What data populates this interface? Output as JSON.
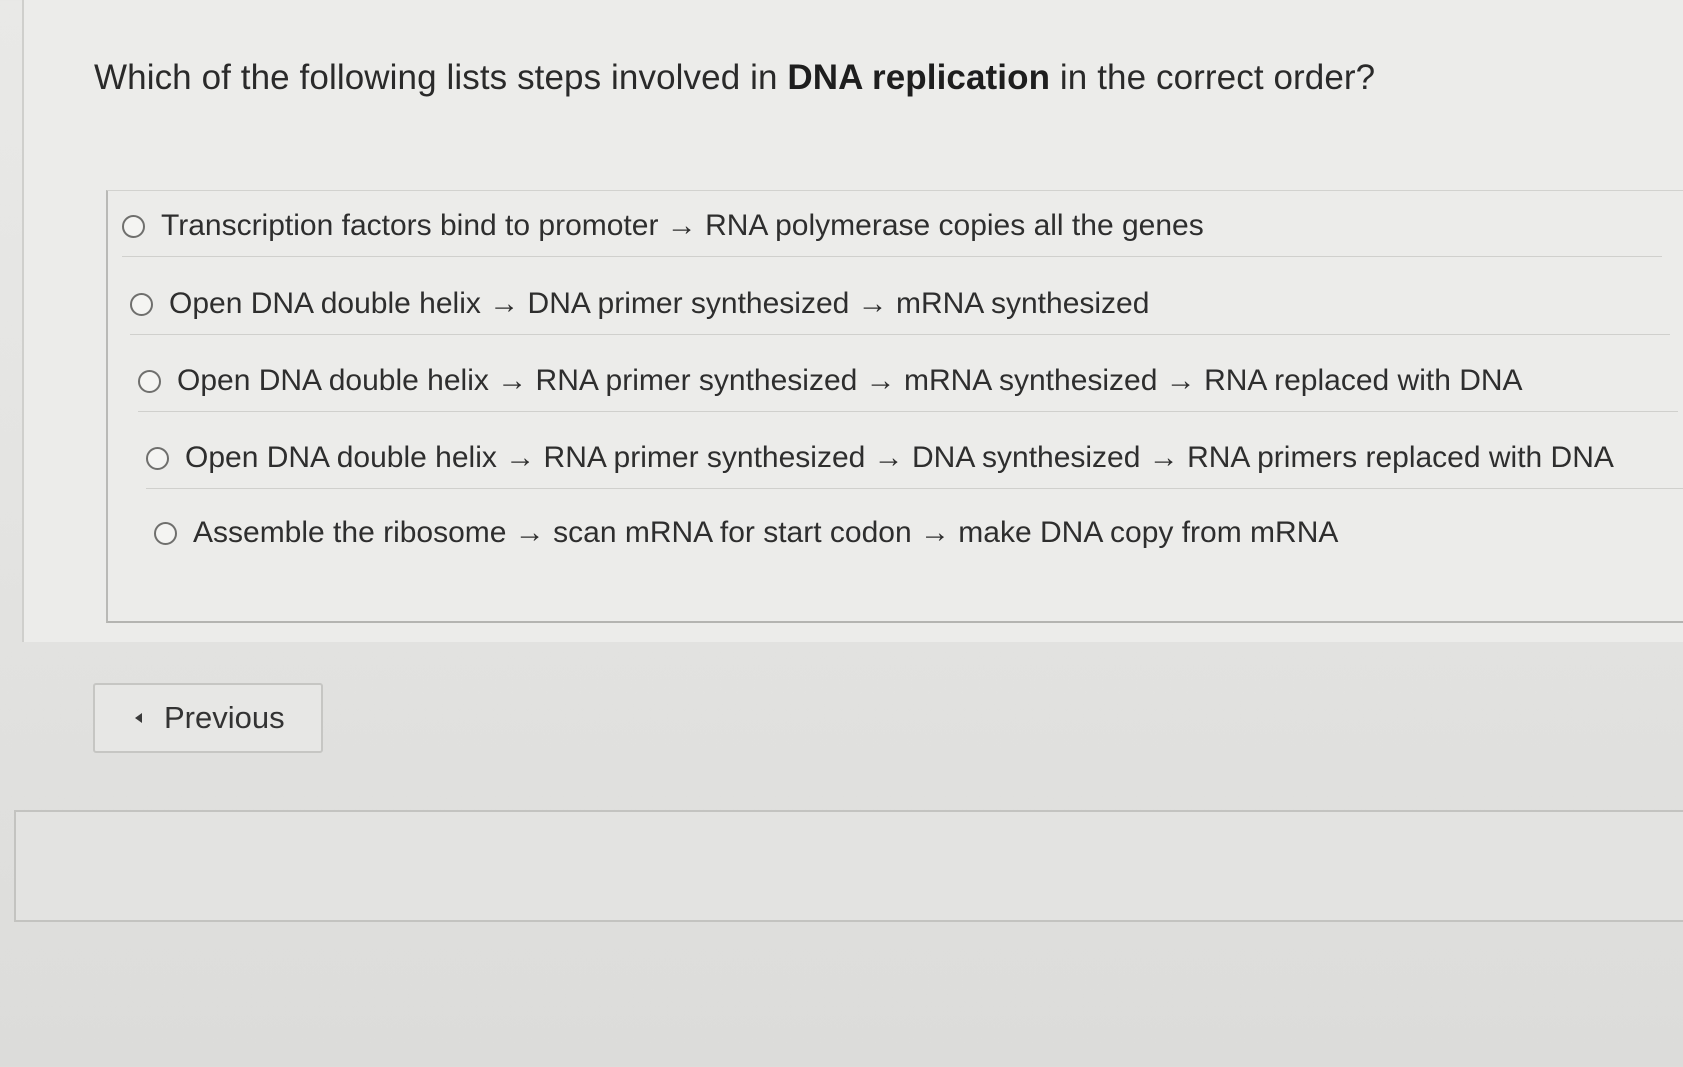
{
  "question": {
    "prefix": "Which of the following lists steps involved in ",
    "emphasis": "DNA replication",
    "suffix": " in the correct order?"
  },
  "options": [
    {
      "label": "Transcription factors bind to promoter → RNA polymerase copies all the genes",
      "selected": false
    },
    {
      "label": "Open DNA double helix → DNA primer synthesized → mRNA synthesized",
      "selected": false
    },
    {
      "label": "Open DNA double helix → RNA primer synthesized → mRNA synthesized → RNA replaced with DNA",
      "selected": false
    },
    {
      "label": "Open DNA double helix → RNA primer synthesized → DNA synthesized → RNA primers replaced with DNA",
      "selected": false
    },
    {
      "label": "Assemble the ribosome → scan mRNA for start codon → make DNA copy from mRNA",
      "selected": false
    }
  ],
  "navigation": {
    "previous_label": "Previous",
    "previous_icon": "caret-left-icon"
  }
}
